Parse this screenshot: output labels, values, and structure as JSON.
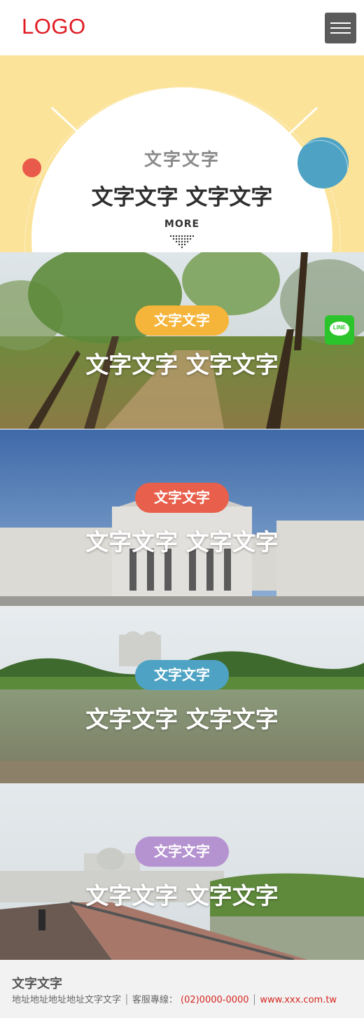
{
  "header": {
    "logo": "LOGO"
  },
  "hero": {
    "subtitle": "文字文字",
    "title": "文字文字 文字文字",
    "more_label": "MORE"
  },
  "banners": [
    {
      "pill": "文字文字",
      "title": "文字文字 文字文字",
      "pill_color": "#f5b43a"
    },
    {
      "pill": "文字文字",
      "title": "文字文字 文字文字",
      "pill_color": "#e8604c"
    },
    {
      "pill": "文字文字",
      "title": "文字文字 文字文字",
      "pill_color": "#4ea3c4"
    },
    {
      "pill": "文字文字",
      "title": "文字文字 文字文字",
      "pill_color": "#b592d0"
    }
  ],
  "floating": {
    "line_label": "LINE"
  },
  "footer": {
    "name": "文字文字",
    "address": "地址地址地址地址文字文字",
    "phone_label": "客服專線：",
    "phone": "(02)0000-0000",
    "website": "www.xxx.com.tw"
  },
  "colors": {
    "brand_red": "#e01b22",
    "hero_bg": "#fbe39a"
  }
}
